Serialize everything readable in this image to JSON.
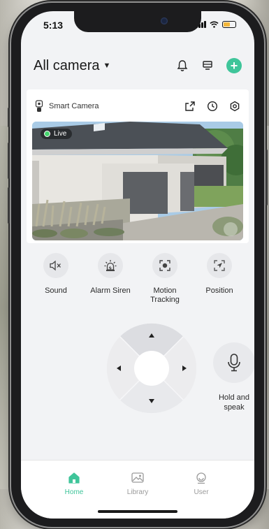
{
  "status_bar": {
    "time": "5:13"
  },
  "header": {
    "title": "All camera"
  },
  "camera": {
    "name": "Smart Camera",
    "live_label": "Live"
  },
  "features": [
    {
      "label": "Sound",
      "icon": "speaker-muted-icon"
    },
    {
      "label": "Alarm Siren",
      "icon": "siren-icon"
    },
    {
      "label": "Motion Tracking",
      "icon": "target-icon"
    },
    {
      "label": "Position",
      "icon": "navigation-arrow-icon"
    }
  ],
  "talk": {
    "label": "Hold and speak"
  },
  "tabs": [
    {
      "label": "Home",
      "active": true
    },
    {
      "label": "Library",
      "active": false
    },
    {
      "label": "User",
      "active": false
    }
  ],
  "colors": {
    "accent": "#3fc59a",
    "live": "#46d46e",
    "battery": "#f3b63a"
  }
}
